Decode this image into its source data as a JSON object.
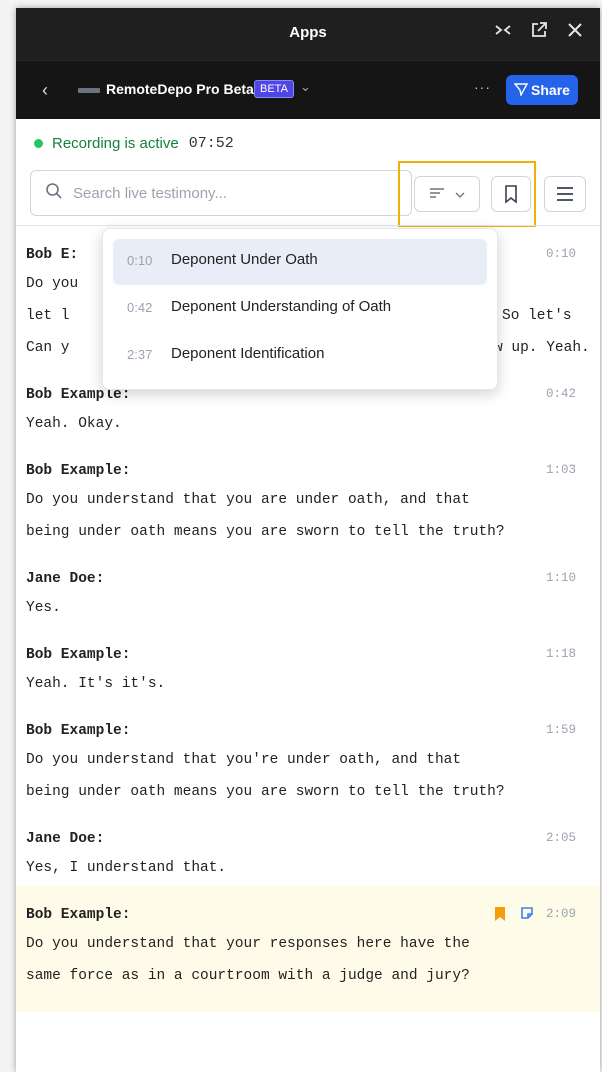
{
  "window": {
    "title": "Apps"
  },
  "app": {
    "name": "RemoteDepo Pro Beta",
    "beta_badge": "BETA",
    "share_label": "Share",
    "more_label": "···"
  },
  "status": {
    "label": "Recording is active",
    "elapsed": "07:52",
    "color": "#22c55e"
  },
  "search": {
    "placeholder": "Search live testimony..."
  },
  "dropdown": {
    "items": [
      {
        "time": "0:10",
        "label": "Deponent Under Oath",
        "selected": true
      },
      {
        "time": "0:42",
        "label": "Deponent Understanding of Oath",
        "selected": false
      },
      {
        "time": "2:37",
        "label": "Deponent Identification",
        "selected": false
      }
    ]
  },
  "transcript": [
    {
      "speaker": "Bob E:",
      "time": "0:10",
      "lines": [
        "Do you",
        "let l",
        "Can y"
      ],
      "lines_right": [
        "",
        "So let's",
        "w up. Yeah."
      ]
    },
    {
      "speaker": "Bob Example:",
      "time": "0:42",
      "lines": [
        "Yeah. Okay."
      ]
    },
    {
      "speaker": "Bob Example:",
      "time": "1:03",
      "lines": [
        "Do you understand that you are under oath, and that",
        "being under oath means you are sworn to tell the truth?"
      ]
    },
    {
      "speaker": "Jane Doe:",
      "time": "1:10",
      "lines": [
        "Yes."
      ]
    },
    {
      "speaker": "Bob Example:",
      "time": "1:18",
      "lines": [
        "Yeah. It's it's."
      ]
    },
    {
      "speaker": "Bob Example:",
      "time": "1:59",
      "lines": [
        "Do you understand that you're under oath, and that",
        "being under oath means you are sworn to tell the truth?"
      ]
    },
    {
      "speaker": "Jane Doe:",
      "time": "2:05",
      "lines": [
        "Yes, I understand that."
      ]
    },
    {
      "speaker": "Bob Example:",
      "time": "2:09",
      "lines": [
        "Do you understand that your responses here have the",
        "same force as in a courtroom with a judge and jury?"
      ]
    }
  ],
  "colors": {
    "accent": "#2563eb",
    "highlight_border": "#eab308",
    "bookmark": "#f59e0b",
    "note": "#3b82f6"
  }
}
